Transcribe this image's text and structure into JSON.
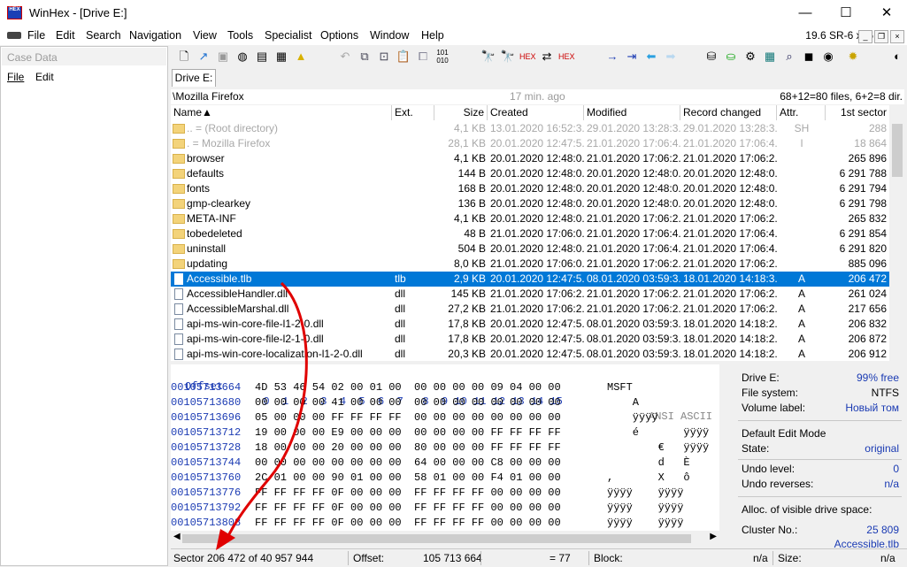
{
  "window": {
    "logo_text": "HEX",
    "title": "WinHex - [Drive E:]",
    "minimize": "—",
    "maximize": "☐",
    "close": "✕"
  },
  "menu": {
    "items": [
      "File",
      "Edit",
      "Search",
      "Navigation",
      "View",
      "Tools",
      "Specialist",
      "Options",
      "Window",
      "Help"
    ],
    "version": "19.6 SR-6 x86"
  },
  "case_panel": {
    "title": "Case Data",
    "menu_file": "File",
    "menu_edit": "Edit"
  },
  "drive_tab": "Drive E:",
  "path_bar": {
    "path": "\\Mozilla Firefox",
    "time": "17 min. ago",
    "counts": "68+12=80 files, 6+2=8 dir."
  },
  "columns": {
    "name": "Name▲",
    "ext": "Ext.",
    "size": "Size",
    "created": "Created",
    "modified": "Modified",
    "record_changed": "Record changed",
    "attr": "Attr.",
    "first_sector": "1st sector"
  },
  "files": [
    {
      "name": "..  =  (Root directory)",
      "ext": "",
      "size": "4,1 KB",
      "created": "13.01.2020  16:52:3...",
      "modified": "29.01.2020  13:28:3...",
      "record": "29.01.2020  13:28:3...",
      "attr": "SH",
      "sector": "288",
      "kind": "folder",
      "state": "dim"
    },
    {
      "name": ".  =  Mozilla Firefox",
      "ext": "",
      "size": "28,1 KB",
      "created": "20.01.2020  12:47:5...",
      "modified": "21.01.2020  17:06:4...",
      "record": "21.01.2020  17:06:4...",
      "attr": "I",
      "sector": "18 864",
      "kind": "folder",
      "state": "dim"
    },
    {
      "name": "browser",
      "ext": "",
      "size": "4,1 KB",
      "created": "20.01.2020  12:48:0...",
      "modified": "21.01.2020  17:06:2...",
      "record": "21.01.2020  17:06:2...",
      "attr": "",
      "sector": "265 896",
      "kind": "folder",
      "state": ""
    },
    {
      "name": "defaults",
      "ext": "",
      "size": "144 B",
      "created": "20.01.2020  12:48:0...",
      "modified": "20.01.2020  12:48:0...",
      "record": "20.01.2020  12:48:0...",
      "attr": "",
      "sector": "6 291 788",
      "kind": "folder",
      "state": ""
    },
    {
      "name": "fonts",
      "ext": "",
      "size": "168 B",
      "created": "20.01.2020  12:48:0...",
      "modified": "20.01.2020  12:48:0...",
      "record": "20.01.2020  12:48:0...",
      "attr": "",
      "sector": "6 291 794",
      "kind": "folder",
      "state": ""
    },
    {
      "name": "gmp-clearkey",
      "ext": "",
      "size": "136 B",
      "created": "20.01.2020  12:48:0...",
      "modified": "20.01.2020  12:48:0...",
      "record": "20.01.2020  12:48:0...",
      "attr": "",
      "sector": "6 291 798",
      "kind": "folder",
      "state": ""
    },
    {
      "name": "META-INF",
      "ext": "",
      "size": "4,1 KB",
      "created": "20.01.2020  12:48:0...",
      "modified": "21.01.2020  17:06:2...",
      "record": "21.01.2020  17:06:2...",
      "attr": "",
      "sector": "265 832",
      "kind": "folder",
      "state": ""
    },
    {
      "name": "tobedeleted",
      "ext": "",
      "size": "48 B",
      "created": "21.01.2020  17:06:0...",
      "modified": "21.01.2020  17:06:4...",
      "record": "21.01.2020  17:06:4...",
      "attr": "",
      "sector": "6 291 854",
      "kind": "folder",
      "state": ""
    },
    {
      "name": "uninstall",
      "ext": "",
      "size": "504 B",
      "created": "20.01.2020  12:48:0...",
      "modified": "21.01.2020  17:06:4...",
      "record": "21.01.2020  17:06:4...",
      "attr": "",
      "sector": "6 291 820",
      "kind": "folder",
      "state": ""
    },
    {
      "name": "updating",
      "ext": "",
      "size": "8,0 KB",
      "created": "21.01.2020  17:06:0...",
      "modified": "21.01.2020  17:06:2...",
      "record": "21.01.2020  17:06:2...",
      "attr": "",
      "sector": "885 096",
      "kind": "folder",
      "state": ""
    },
    {
      "name": "Accessible.tlb",
      "ext": "tlb",
      "size": "2,9 KB",
      "created": "20.01.2020  12:47:5...",
      "modified": "08.01.2020  03:59:3...",
      "record": "18.01.2020  14:18:3...",
      "attr": "A",
      "sector": "206 472",
      "kind": "file",
      "state": "sel"
    },
    {
      "name": "AccessibleHandler.dll",
      "ext": "dll",
      "size": "145 KB",
      "created": "21.01.2020  17:06:2...",
      "modified": "21.01.2020  17:06:2...",
      "record": "21.01.2020  17:06:2...",
      "attr": "A",
      "sector": "261 024",
      "kind": "file",
      "state": ""
    },
    {
      "name": "AccessibleMarshal.dll",
      "ext": "dll",
      "size": "27,2 KB",
      "created": "21.01.2020  17:06:2...",
      "modified": "21.01.2020  17:06:2...",
      "record": "21.01.2020  17:06:2...",
      "attr": "A",
      "sector": "217 656",
      "kind": "file",
      "state": ""
    },
    {
      "name": "api-ms-win-core-file-l1-2-0.dll",
      "ext": "dll",
      "size": "17,8 KB",
      "created": "20.01.2020  12:47:5...",
      "modified": "08.01.2020  03:59:3...",
      "record": "18.01.2020  14:18:2...",
      "attr": "A",
      "sector": "206 832",
      "kind": "file",
      "state": ""
    },
    {
      "name": "api-ms-win-core-file-l2-1-0.dll",
      "ext": "dll",
      "size": "17,8 KB",
      "created": "20.01.2020  12:47:5...",
      "modified": "08.01.2020  03:59:3...",
      "record": "18.01.2020  14:18:2...",
      "attr": "A",
      "sector": "206 872",
      "kind": "file",
      "state": ""
    },
    {
      "name": "api-ms-win-core-localization-l1-2-0.dll",
      "ext": "dll",
      "size": "20,3 KB",
      "created": "20.01.2020  12:47:5...",
      "modified": "08.01.2020  03:59:3...",
      "record": "18.01.2020  14:18:2...",
      "attr": "A",
      "sector": "206 912",
      "kind": "file",
      "state": ""
    }
  ],
  "hex": {
    "offset_label": "Offset",
    "col_header": "  0  1  2  3  4  5  6  7   8  9 10 11 12 13 14 15",
    "ansi_label": "ANSI ASCII",
    "rows": [
      {
        "offset": "00105713664",
        "bytes": "4D 53 46 54 02 00 01 00  00 00 00 00 09 04 00 00",
        "ansi": "MSFT"
      },
      {
        "offset": "00105713680",
        "bytes": "00 00 00 00 41 00 00 00  00 00 00 00 00 00 00 00",
        "ansi": "    A"
      },
      {
        "offset": "00105713696",
        "bytes": "05 00 00 00 FF FF FF FF  00 00 00 00 00 00 00 00",
        "ansi": "    ÿÿÿÿ"
      },
      {
        "offset": "00105713712",
        "bytes": "19 00 00 00 E9 00 00 00  00 00 00 00 FF FF FF FF",
        "ansi": "    é       ÿÿÿÿ"
      },
      {
        "offset": "00105713728",
        "bytes": "18 00 00 00 20 00 00 00  80 00 00 00 FF FF FF FF",
        "ansi": "        €   ÿÿÿÿ"
      },
      {
        "offset": "00105713744",
        "bytes": "00 00 00 00 00 00 00 00  64 00 00 00 C8 00 00 00",
        "ansi": "        d   È"
      },
      {
        "offset": "00105713760",
        "bytes": "2C 01 00 00 90 01 00 00  58 01 00 00 F4 01 00 00",
        "ansi": ",       X   ô"
      },
      {
        "offset": "00105713776",
        "bytes": "FF FF FF FF 0F 00 00 00  FF FF FF FF 00 00 00 00",
        "ansi": "ÿÿÿÿ    ÿÿÿÿ"
      },
      {
        "offset": "00105713792",
        "bytes": "FF FF FF FF 0F 00 00 00  FF FF FF FF 00 00 00 00",
        "ansi": "ÿÿÿÿ    ÿÿÿÿ"
      },
      {
        "offset": "00105713808",
        "bytes": "FF FF FF FF 0F 00 00 00  FF FF FF FF 00 00 00 00",
        "ansi": "ÿÿÿÿ    ÿÿÿÿ"
      }
    ]
  },
  "info": {
    "drive_label": "Drive E:",
    "drive_free": "99% free",
    "fs_label": "File system:",
    "fs_value": "NTFS",
    "vol_label": "Volume label:",
    "vol_value": "Новый том",
    "edit_mode_title": "Default Edit Mode",
    "state_label": "State:",
    "state_value": "original",
    "undo_level_label": "Undo level:",
    "undo_level_value": "0",
    "undo_rev_label": "Undo reverses:",
    "undo_rev_value": "n/a",
    "alloc_title": "Alloc. of visible drive space:",
    "cluster_label": "Cluster No.:",
    "cluster_value": "25 809",
    "cluster_file": "Accessible.tlb"
  },
  "status": {
    "sector": "Sector 206 472 of 40 957 944",
    "offset_label": "Offset:",
    "offset_value": "105 713 664",
    "eq": "= 77",
    "block_label": "Block:",
    "block_value": "n/a",
    "size_label": "Size:",
    "size_value": "n/a"
  },
  "colors": {
    "selection": "#0078d7",
    "offset_blue": "#1b3bb3",
    "annotation_red": "#e00000"
  }
}
